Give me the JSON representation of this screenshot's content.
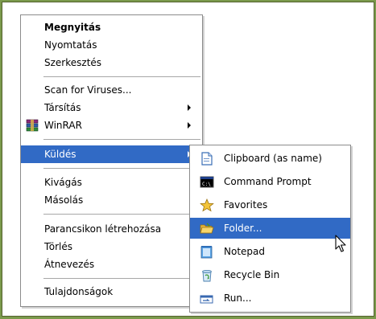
{
  "menu": {
    "items": [
      {
        "label": "Megnyitás",
        "kind": "default"
      },
      {
        "label": "Nyomtatás"
      },
      {
        "label": "Szerkesztés"
      },
      {
        "label": "Scan for Viruses..."
      },
      {
        "label": "Társítás",
        "submenu": true
      },
      {
        "label": "WinRAR",
        "submenu": true,
        "icon": "winrar-icon"
      },
      {
        "label": "Küldés",
        "submenu": true,
        "selected": true
      },
      {
        "label": "Kivágás"
      },
      {
        "label": "Másolás"
      },
      {
        "label": "Parancsikon létrehozása"
      },
      {
        "label": "Törlés"
      },
      {
        "label": "Átnevezés"
      },
      {
        "label": "Tulajdonságok"
      }
    ]
  },
  "submenu": {
    "items": [
      {
        "label": "Clipboard (as name)",
        "icon": "clipboard-icon"
      },
      {
        "label": "Command Prompt",
        "icon": "command-prompt-icon"
      },
      {
        "label": "Favorites",
        "icon": "star-icon"
      },
      {
        "label": "Folder...",
        "icon": "folder-icon",
        "selected": true
      },
      {
        "label": "Notepad",
        "icon": "notepad-icon"
      },
      {
        "label": "Recycle Bin",
        "icon": "recycle-bin-icon"
      },
      {
        "label": "Run...",
        "icon": "run-icon"
      }
    ],
    "cmd_icon_text": "C:\\"
  },
  "colors": {
    "highlight": "#316ac5",
    "highlight_text": "#ffffff",
    "background_frame": "#7b9a4c"
  }
}
